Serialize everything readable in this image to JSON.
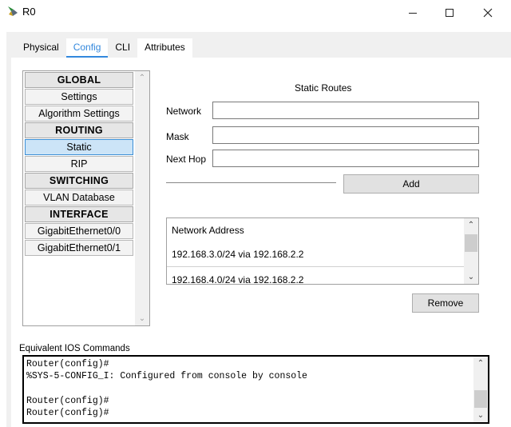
{
  "window": {
    "title": "R0",
    "minimize_icon": "minimize-icon",
    "maximize_icon": "maximize-icon",
    "close_icon": "close-icon"
  },
  "tabs": [
    {
      "label": "Physical"
    },
    {
      "label": "Config",
      "active": true
    },
    {
      "label": "CLI"
    },
    {
      "label": "Attributes"
    }
  ],
  "menu": {
    "items": [
      {
        "label": "GLOBAL",
        "type": "header"
      },
      {
        "label": "Settings",
        "type": "item"
      },
      {
        "label": "Algorithm Settings",
        "type": "item"
      },
      {
        "label": "ROUTING",
        "type": "header"
      },
      {
        "label": "Static",
        "type": "item",
        "selected": true
      },
      {
        "label": "RIP",
        "type": "item"
      },
      {
        "label": "SWITCHING",
        "type": "header"
      },
      {
        "label": "VLAN Database",
        "type": "item"
      },
      {
        "label": "INTERFACE",
        "type": "header"
      },
      {
        "label": "GigabitEthernet0/0",
        "type": "item"
      },
      {
        "label": "GigabitEthernet0/1",
        "type": "item"
      }
    ]
  },
  "static_routes": {
    "title": "Static Routes",
    "network_label": "Network",
    "network_value": "",
    "mask_label": "Mask",
    "mask_value": "",
    "next_hop_label": "Next Hop",
    "next_hop_value": "",
    "add_label": "Add",
    "list_header": "Network Address",
    "routes": [
      "192.168.3.0/24 via 192.168.2.2",
      "192.168.4.0/24 via 192.168.2.2"
    ],
    "remove_label": "Remove"
  },
  "ios": {
    "label": "Equivalent IOS Commands",
    "lines": [
      "Router(config)#",
      "%SYS-5-CONFIG_I: Configured from console by console",
      "",
      "Router(config)#",
      "Router(config)#"
    ]
  },
  "colors": {
    "accent": "#3388dd",
    "selected_bg": "#cce4f7"
  }
}
